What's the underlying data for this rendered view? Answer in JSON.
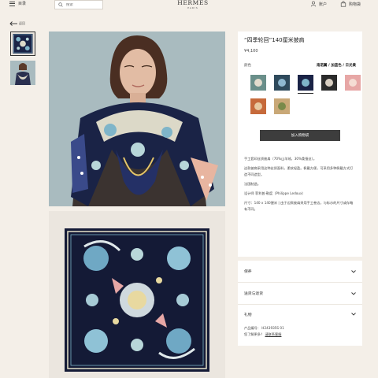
{
  "header": {
    "menu_label": "目录",
    "search_placeholder": "搜索",
    "logo_main": "HERMÈS",
    "logo_sub": "PARIS",
    "account_label": "账户",
    "cart_label": "购物袋"
  },
  "nav": {
    "back_label": "返回"
  },
  "product": {
    "title": "“四季轮回”140厘米披肩",
    "price": "¥4,100",
    "color_label": "颜色",
    "color_name": "南诺翼 / 加蓝色 / 日光黄",
    "add_to_cart": "加入购物袋",
    "description": [
      "手工套印丝质披肩（70%山羊绒，30%桑蚕丝）。",
      "这款披肩采用这种丝质面料，柔软轻盈。佩戴方便，可采用多种佩戴方式打造不同造型。",
      "法国制造。",
      "设计师 菲利普·勒度（Philippe Ledoux）",
      "尺寸：140 x 140厘米 | 由于边款披肩采用手工卷边，与标示的尺寸或存略有不同。"
    ]
  },
  "accordion": {
    "care": "保养",
    "shipping": "送货与退货",
    "gift": "礼物"
  },
  "extra": {
    "ref_label": "产品编号：",
    "ref_value": "H243935S 01",
    "question": "您了解更多？",
    "contact_link": "请联系客服"
  },
  "swatches": [
    {
      "name": "swatch-1",
      "main": "#6a8f8a",
      "accent": "#e3dccd"
    },
    {
      "name": "swatch-2",
      "main": "#2e4a5c",
      "accent": "#8fb8d0"
    },
    {
      "name": "swatch-3",
      "main": "#1a2346",
      "accent": "#7fb5c9"
    },
    {
      "name": "swatch-4",
      "main": "#2b2b2b",
      "accent": "#d9cfc2"
    },
    {
      "name": "swatch-5",
      "main": "#e7a7a6",
      "accent": "#f5dcd4"
    },
    {
      "name": "swatch-6",
      "main": "#c66a3b",
      "accent": "#e8c9a0"
    },
    {
      "name": "swatch-7",
      "main": "#c9a877",
      "accent": "#7a8a4a"
    }
  ],
  "colors": {
    "background": "#f4efe8",
    "panel": "#ffffff",
    "button": "#3d3d3d",
    "scarf_navy": "#1a2346",
    "scarf_teal": "#7fb5c9"
  }
}
